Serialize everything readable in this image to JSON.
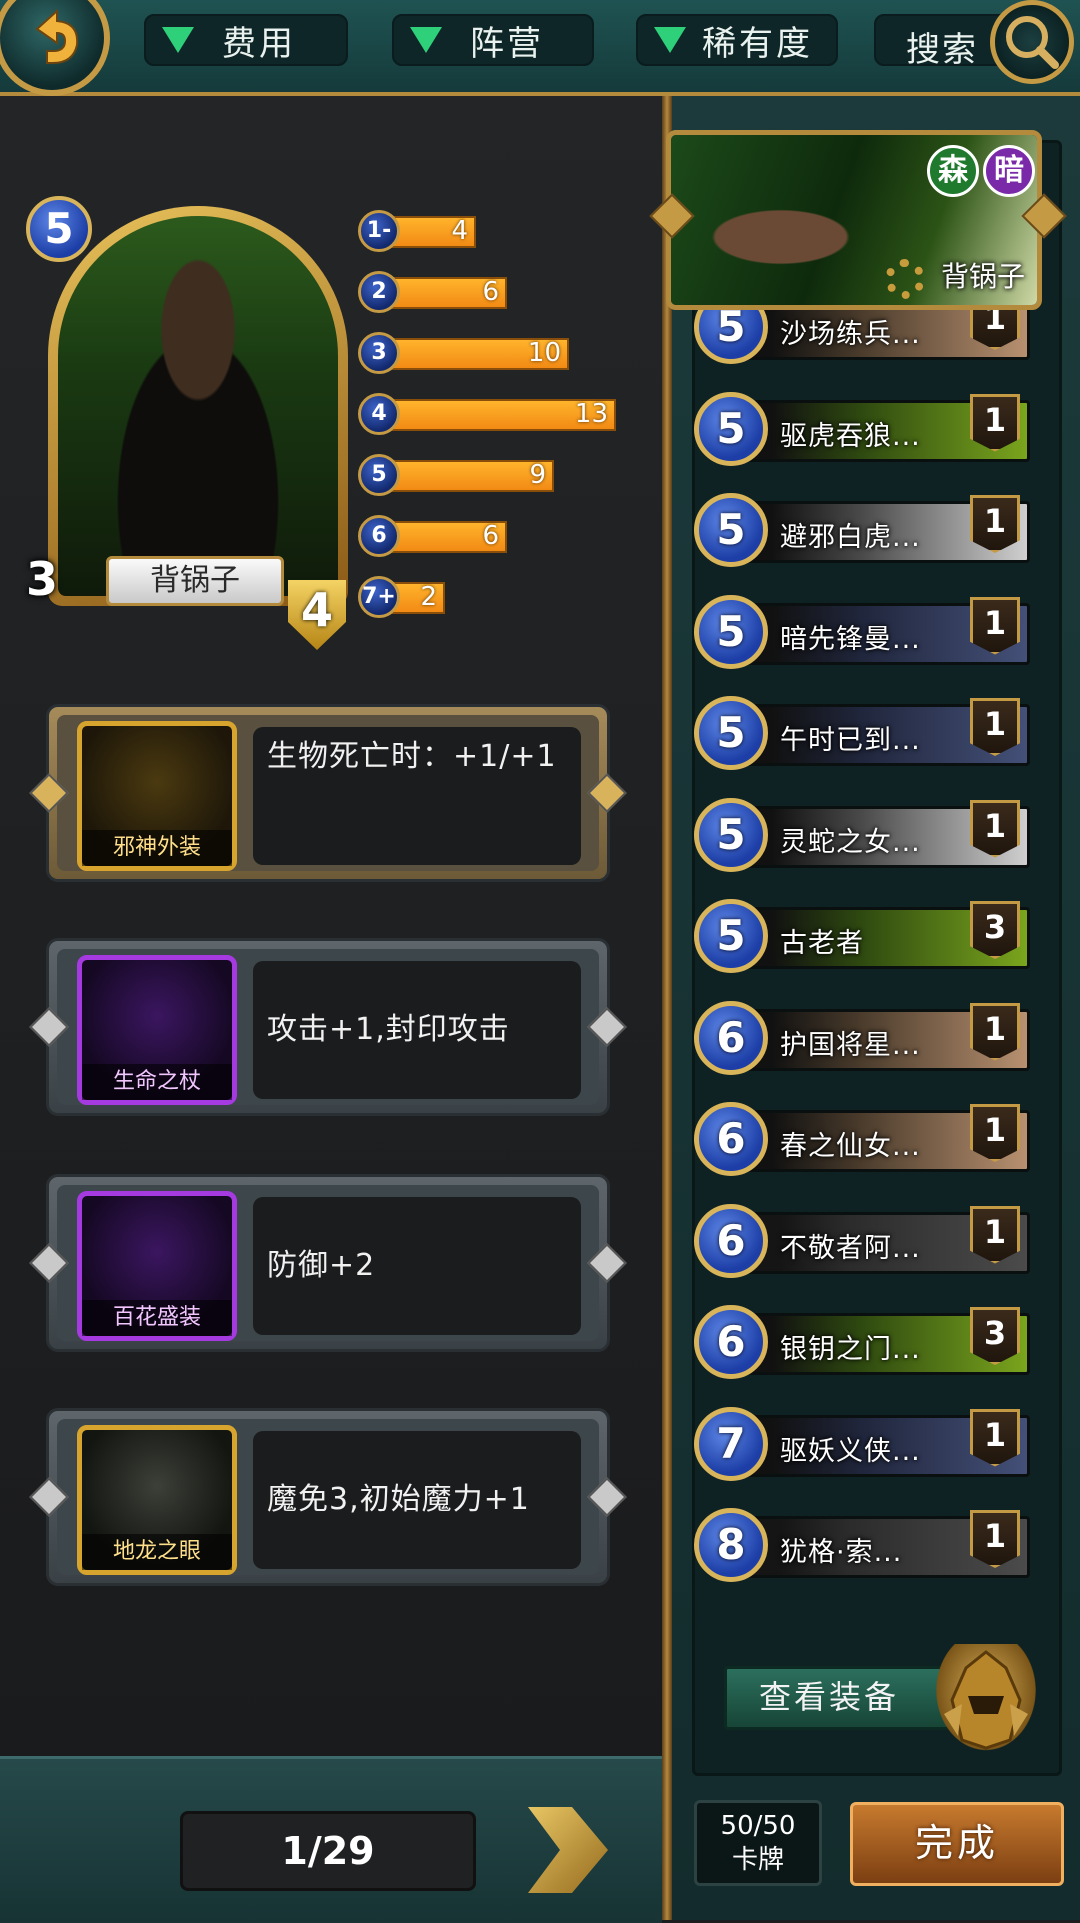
{
  "filters": {
    "cost": "费用",
    "faction": "阵营",
    "rarity": "稀有度",
    "search": "搜索"
  },
  "icons": {
    "back": "back-arrow-icon",
    "search": "magnifier-icon"
  },
  "hero": {
    "name": "背锅子",
    "cost": "5",
    "attack": "3",
    "defense": "4"
  },
  "mana_curve": [
    {
      "label": "1-",
      "count": 4
    },
    {
      "label": "2",
      "count": 6
    },
    {
      "label": "3",
      "count": 10
    },
    {
      "label": "4",
      "count": 13
    },
    {
      "label": "5",
      "count": 9
    },
    {
      "label": "6",
      "count": 6
    },
    {
      "label": "7+",
      "count": 2
    }
  ],
  "equipment": [
    {
      "name": "邪神外装",
      "effect": "生物死亡时：+1/+1",
      "rarity": "gold"
    },
    {
      "name": "生命之杖",
      "effect": "攻击+1,封印攻击",
      "rarity": "purple"
    },
    {
      "name": "百花盛装",
      "effect": "防御+2",
      "rarity": "purple"
    },
    {
      "name": "地龙之眼",
      "effect": "魔免3,初始魔力+1",
      "rarity": "gold"
    }
  ],
  "pager": "1/29",
  "deck": {
    "hero_name": "背锅子",
    "factions": [
      "森",
      "暗"
    ],
    "cards": [
      {
        "cost": "5",
        "name": "沙场练兵...",
        "count": "1"
      },
      {
        "cost": "5",
        "name": "驱虎吞狼...",
        "count": "1"
      },
      {
        "cost": "5",
        "name": "避邪白虎...",
        "count": "1"
      },
      {
        "cost": "5",
        "name": "暗先锋曼...",
        "count": "1"
      },
      {
        "cost": "5",
        "name": "午时已到...",
        "count": "1"
      },
      {
        "cost": "5",
        "name": "灵蛇之女...",
        "count": "1"
      },
      {
        "cost": "5",
        "name": "古老者",
        "count": "3"
      },
      {
        "cost": "6",
        "name": "护国将星...",
        "count": "1"
      },
      {
        "cost": "6",
        "name": "春之仙女...",
        "count": "1"
      },
      {
        "cost": "6",
        "name": "不敬者阿...",
        "count": "1"
      },
      {
        "cost": "6",
        "name": "银钥之门...",
        "count": "3"
      },
      {
        "cost": "7",
        "name": "驱妖义侠...",
        "count": "1"
      },
      {
        "cost": "8",
        "name": "犹格·索...",
        "count": "1"
      }
    ],
    "view_equipment": "查看装备",
    "card_count": "50/50",
    "card_count_label": "卡牌",
    "done": "完成"
  },
  "colors": {
    "accent_gold": "#c59a45",
    "bar_orange": "#f7a020",
    "mana_blue": "#2a50c0",
    "teal_bar": "#1f5352"
  }
}
